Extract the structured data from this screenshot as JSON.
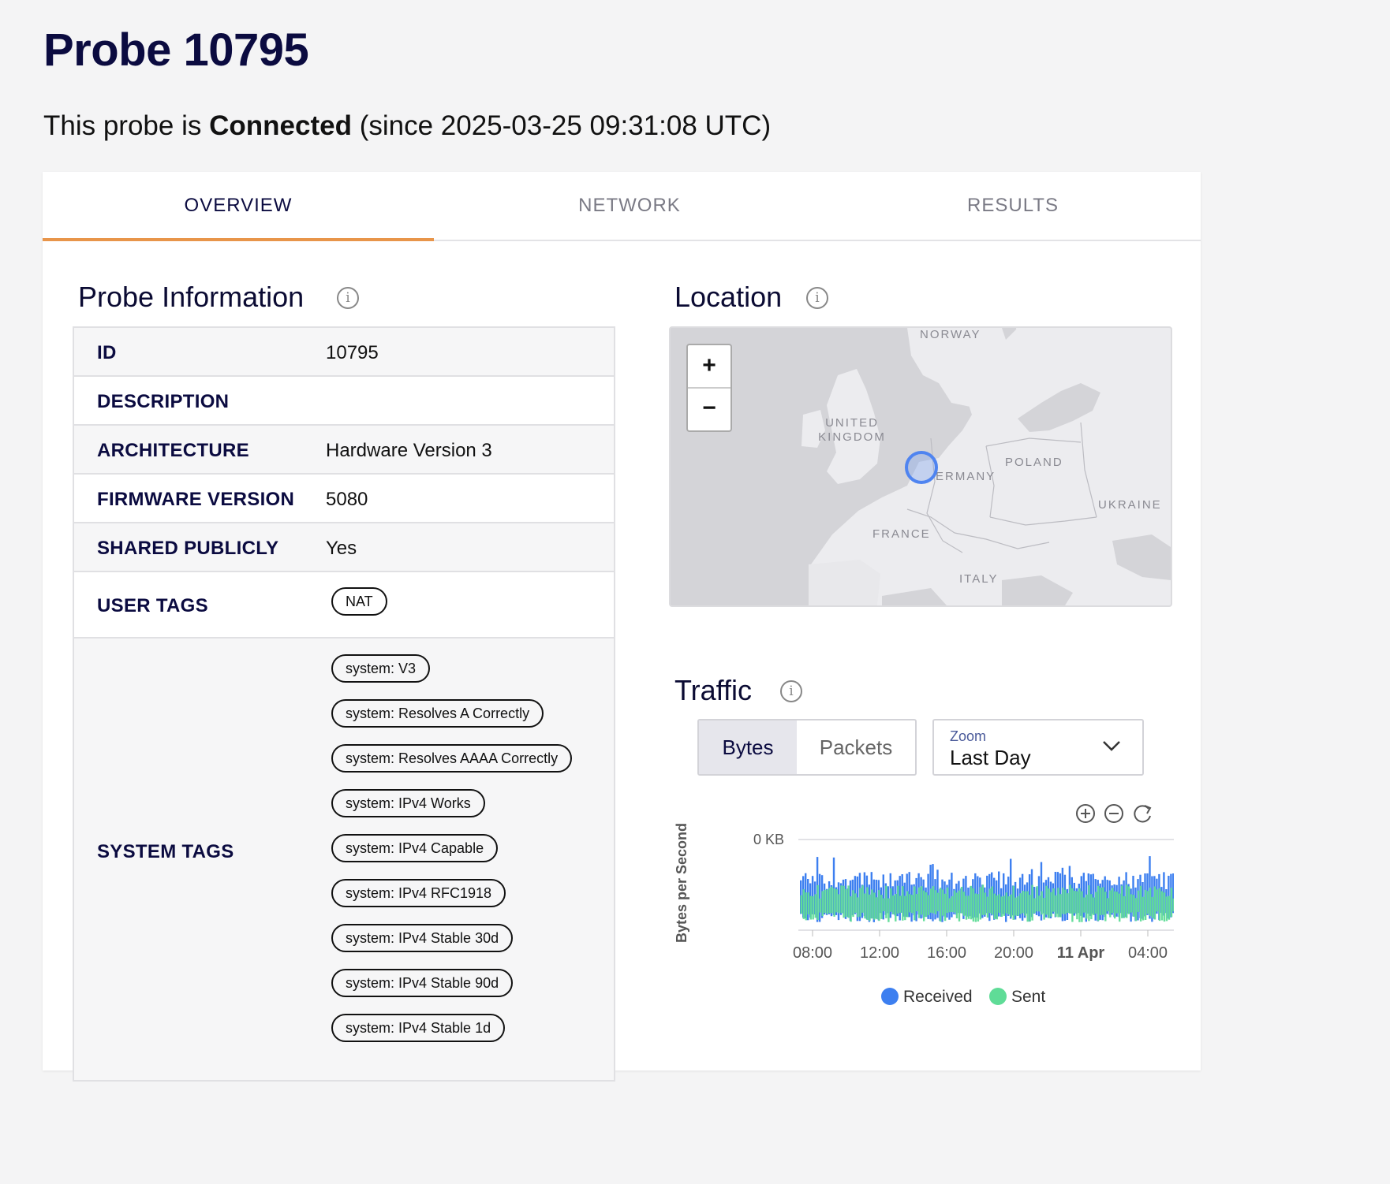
{
  "page": {
    "title": "Probe 10795",
    "status_prefix": "This probe is",
    "status_value": "Connected",
    "status_suffix": "(since 2025-03-25 09:31:08 UTC)"
  },
  "tabs": [
    {
      "label": "OVERVIEW",
      "active": true
    },
    {
      "label": "NETWORK",
      "active": false
    },
    {
      "label": "RESULTS",
      "active": false
    }
  ],
  "probe_info": {
    "title": "Probe Information",
    "rows": [
      {
        "label": "ID",
        "value": "10795"
      },
      {
        "label": "DESCRIPTION",
        "value": ""
      },
      {
        "label": "ARCHITECTURE",
        "value": "Hardware Version 3"
      },
      {
        "label": "FIRMWARE VERSION",
        "value": "5080"
      },
      {
        "label": "SHARED PUBLICLY",
        "value": "Yes"
      }
    ],
    "user_tags_label": "USER TAGS",
    "user_tags": [
      "NAT"
    ],
    "system_tags_label": "SYSTEM TAGS",
    "system_tags": [
      "system: V3",
      "system: Resolves A Correctly",
      "system: Resolves AAAA Correctly",
      "system: IPv4 Works",
      "system: IPv4 Capable",
      "system: IPv4 RFC1918",
      "system: IPv4 Stable 30d",
      "system: IPv4 Stable 90d",
      "system: IPv4 Stable 1d"
    ]
  },
  "location": {
    "title": "Location",
    "zoom_in": "+",
    "zoom_out": "−",
    "labels": {
      "norway": "NORWAY",
      "uk": "UNITED\nKINGDOM",
      "germany": "ERMANY",
      "poland": "POLAND",
      "ukraine": "UKRAINE",
      "france": "FRANCE",
      "italy": "ITALY"
    }
  },
  "traffic": {
    "title": "Traffic",
    "toggle": [
      {
        "label": "Bytes",
        "active": true
      },
      {
        "label": "Packets",
        "active": false
      }
    ],
    "zoom_label": "Zoom",
    "zoom_value": "Last Day",
    "controls": [
      "zoom-in-icon",
      "zoom-out-icon",
      "reset-icon"
    ]
  },
  "chart_data": {
    "type": "line",
    "ylabel": "Bytes per Second",
    "y_tick_labels": [
      "0 KB"
    ],
    "x_tick_labels": [
      "08:00",
      "12:00",
      "16:00",
      "20:00",
      "11 Apr",
      "04:00"
    ],
    "series": [
      {
        "name": "Received",
        "color": "#3d7ff0"
      },
      {
        "name": "Sent",
        "color": "#5fdc97"
      }
    ],
    "legend_position": "bottom",
    "grid": true
  }
}
